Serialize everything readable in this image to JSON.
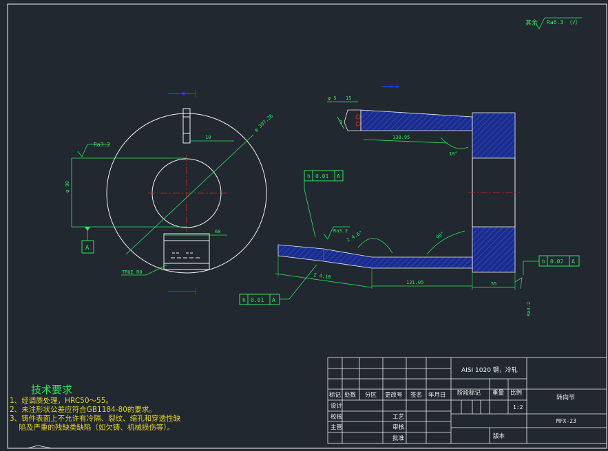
{
  "surface_roughness": {
    "text": "其余",
    "symbol_value": "Ra6.3 （√）"
  },
  "views": {
    "left": {
      "roughness": "Ra3.2",
      "dim_diameter_outer": "φ 397.36",
      "dim_slot_width": "10",
      "dim_diameter_inner": "φ 90",
      "datum_label": "A",
      "dim_bottom": "60",
      "true_radius": "TRUE  R8"
    },
    "right": {
      "label_c1": "C 2",
      "label_cross": "φ 5",
      "dim_15": "15",
      "dim_3": "3",
      "dim_top_len": "138.95",
      "dim_angle_top": "10°",
      "tol_h1": {
        "symbol": "h",
        "value": "0.01",
        "datum": "A"
      },
      "roughness_mid": "Ra3.2",
      "dim_46": "Z 4.6°",
      "dim_angle_90": "90°",
      "tol_b": {
        "symbol": "b",
        "value": "0.02",
        "datum": "A"
      },
      "dim_bottom_len": "Z 4.10",
      "dim_131": "131.05",
      "dim_55": "55",
      "tol_h2": {
        "symbol": "h",
        "value": "0.01",
        "datum": "A"
      },
      "roughness_side": "Ra3.2"
    }
  },
  "tech_req": {
    "title": "技术要求",
    "lines": [
      "1、经调质处理，HRC50～55。",
      "2、未注形状公差应符合GB1184-80的要求。",
      "3、铸件表面上不允许有冷隔、裂纹、缩孔和穿透性缺",
      "    陷及严重的残缺类缺陷（如欠铸、机械损伤等）。"
    ]
  },
  "title_block": {
    "material": "AISI 1020 钢，冷轧",
    "part_name": "转向节",
    "drawing_no": "MFX-23",
    "scale_value": "1:2",
    "headers": [
      "标记",
      "处数",
      "分区",
      "更改号",
      "签名",
      "年月日"
    ],
    "col_stage": "阶段标记",
    "col_weight": "重量",
    "col_scale": "比例",
    "row_design": "设计",
    "row_check": "校核",
    "row_chief": "主管",
    "row_process": "工艺",
    "row_review": "审核",
    "row_approve": "批准",
    "version": "版本"
  }
}
